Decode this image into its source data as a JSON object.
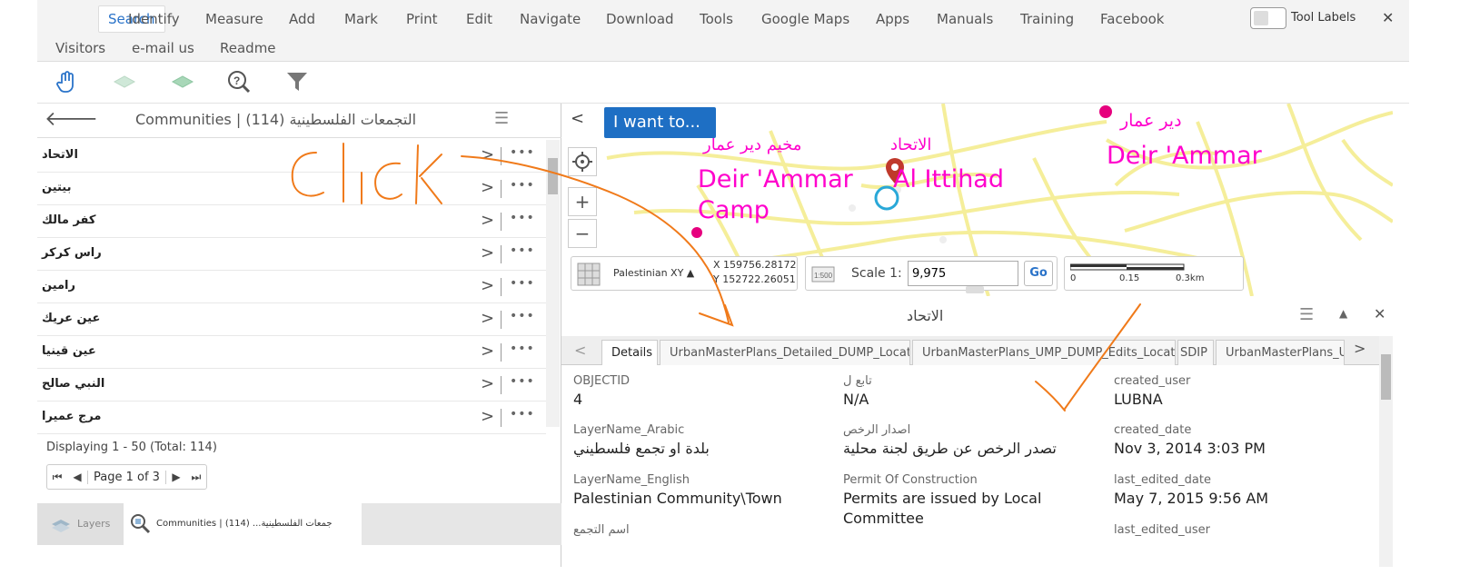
{
  "menu": {
    "items": [
      "Search",
      "Identify",
      "Measure",
      "Add",
      "Mark",
      "Print",
      "Edit",
      "Navigate",
      "Download",
      "Tools",
      "Google Maps",
      "Apps",
      "Manuals",
      "Training",
      "Facebook"
    ],
    "items_row2": [
      "Visitors",
      "e-mail us",
      "Readme"
    ],
    "tool_labels": "Tool Labels",
    "close": "✕"
  },
  "toolbar": {
    "icons": [
      "pan-hand-icon",
      "previous-extent-icon",
      "next-extent-icon",
      "identify-help-icon",
      "filter-icon"
    ]
  },
  "left_panel": {
    "back": "🡐",
    "title": "Communities | (114) التجمعات الفلسطينية",
    "menu": "☰",
    "rows": [
      "الاتحاد",
      "بيتين",
      "كفر مالك",
      "راس كركر",
      "رامين",
      "عين عريك",
      "عين قينيا",
      "النبي صالح",
      "مرج عميرا"
    ],
    "chevron": ">",
    "more": "•••",
    "display_count": "Displaying 1 - 50 (Total: 114)",
    "pager": {
      "first": "⏮",
      "prev": "◀",
      "label": "Page 1 of 3",
      "next": "▶",
      "last": "⏭"
    },
    "bottom_tabs": {
      "layers": "Layers",
      "communities": "Communities | (114) ...جمعات الفلسطينية"
    }
  },
  "map": {
    "i_want_to": "I want to...",
    "collapse": "<",
    "zoom_in": "+",
    "zoom_out": "−",
    "labels": {
      "deir_ammar_camp_ar": "مخيم دير عمار",
      "deir_ammar_camp_en_1": "Deir 'Ammar",
      "deir_ammar_camp_en_2": "Camp",
      "ittihad_ar": "الاتحاد",
      "ittihad_en": "Al Ittihad",
      "deir_ammar_ar": "دير عمار",
      "deir_ammar_en": "Deir 'Ammar"
    },
    "footer": {
      "crs": "Palestinian XY ▲",
      "x": "X 159756.28172",
      "y": "Y 152722.26051",
      "scale_label": "Scale 1:",
      "scale_value": "9,975",
      "go": "Go",
      "scalebar_0": "0",
      "scalebar_1": "0.15",
      "scalebar_2": "0.3km"
    }
  },
  "details": {
    "title": "الاتحاد",
    "tabs": [
      "Details",
      "UrbanMasterPlans_Detailed_DUMP_Locations",
      "UrbanMasterPlans_UMP_DUMP_Edits_Locations",
      "SDIP",
      "UrbanMasterPlans_UM"
    ],
    "fields": [
      {
        "label": "OBJECTID",
        "value": "4"
      },
      {
        "label": "تابع ل",
        "value": "N/A"
      },
      {
        "label": "created_user",
        "value": "LUBNA"
      },
      {
        "label": "LayerName_Arabic",
        "value": "بلدة او تجمع فلسطيني"
      },
      {
        "label": "اصدار الرخص",
        "value": "تصدر الرخص عن طريق لجنة محلية"
      },
      {
        "label": "created_date",
        "value": "Nov 3, 2014 3:03 PM"
      },
      {
        "label": "LayerName_English",
        "value": "Palestinian Community\\Town"
      },
      {
        "label": "Permit Of Construction",
        "value": "Permits are issued by Local"
      },
      {
        "label": "last_edited_date",
        "value": "May 7, 2015 9:56 AM"
      },
      {
        "label": "اسم التجمع",
        "value": ""
      },
      {
        "label": "",
        "value": "Committee"
      },
      {
        "label": "last_edited_user",
        "value": ""
      }
    ]
  },
  "annotation": {
    "text": "Click",
    "color": "#f07a1a"
  }
}
